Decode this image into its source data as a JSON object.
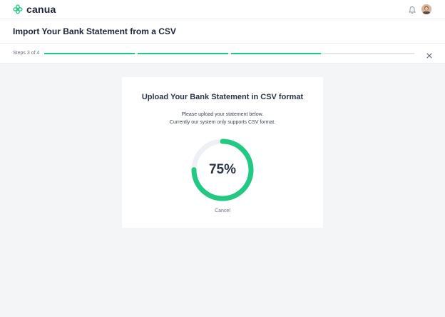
{
  "app": {
    "brand": "canua",
    "logo_icon": "canua-logo-icon",
    "brand_color": "#22c983"
  },
  "header": {
    "notification_icon": "bell-icon",
    "avatar_icon": "user-avatar"
  },
  "page": {
    "title": "Import Your Bank Statement from a CSV"
  },
  "steps": {
    "label": "Steps 3 of 4",
    "current": 3,
    "total": 4,
    "close_icon": "close-icon"
  },
  "upload": {
    "title": "Upload Your Bank Statement in CSV format",
    "description_line1": "Please upload your statement below.",
    "description_line2": "Currently our system only supports CSV format.",
    "progress_percent": 75,
    "progress_label": "75%",
    "cancel_label": "Cancel"
  }
}
